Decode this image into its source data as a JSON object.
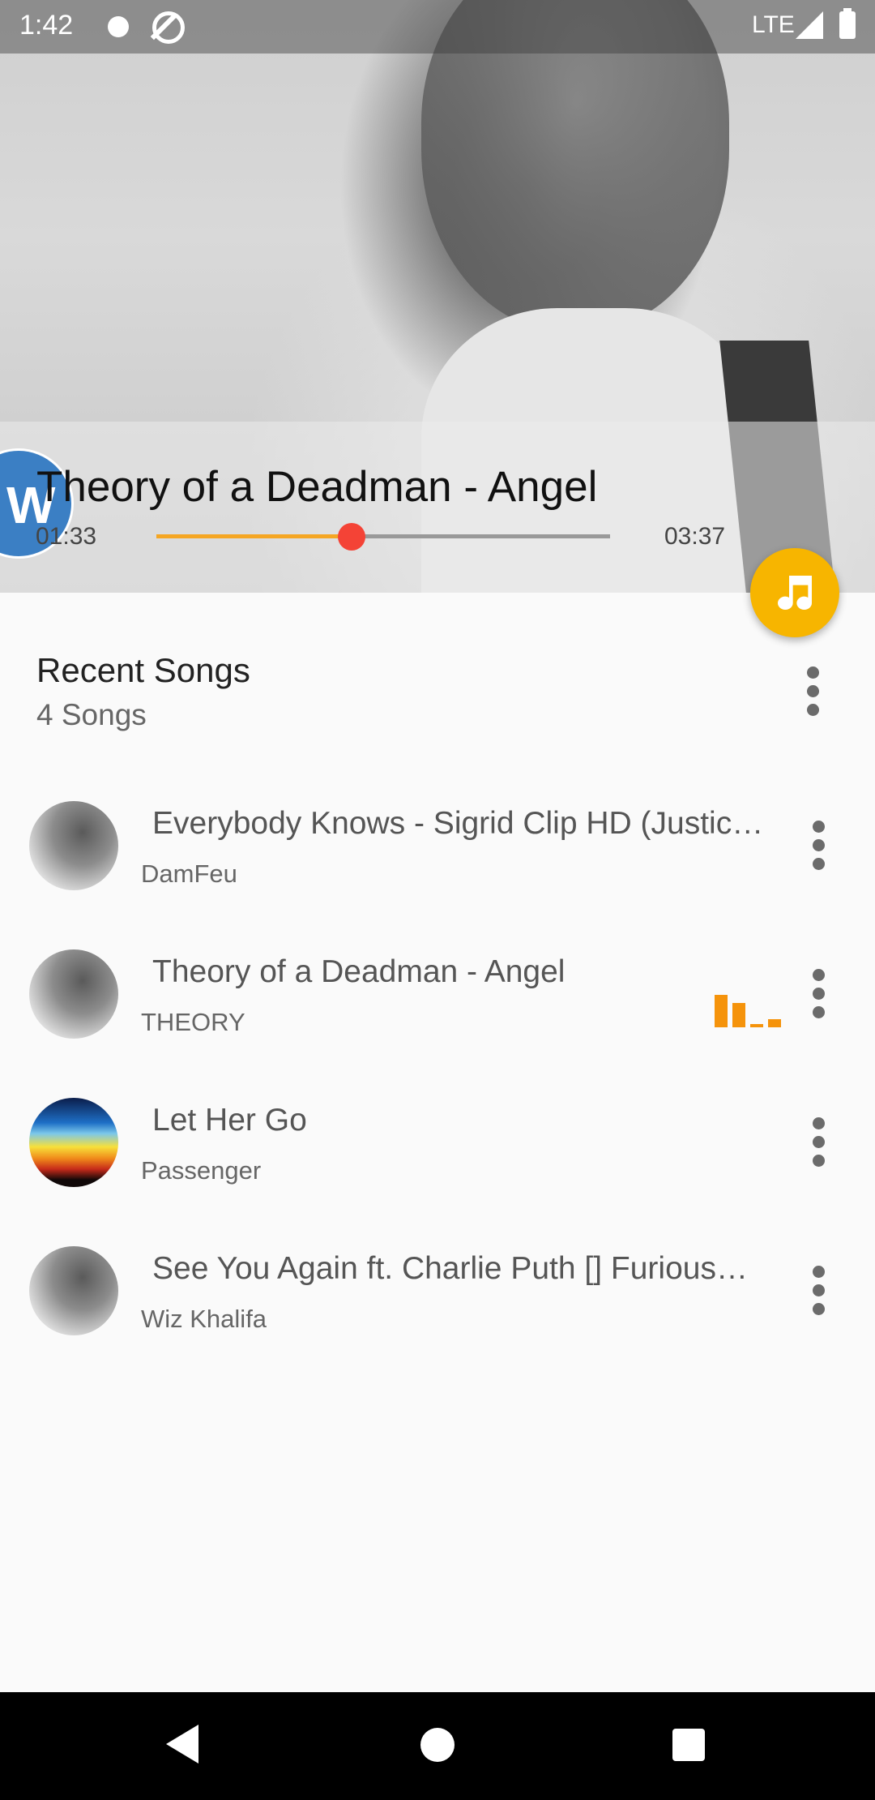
{
  "status_bar": {
    "time": "1:42",
    "network": "LTE"
  },
  "now_playing": {
    "title": "Theory of a Deadman - Angel",
    "elapsed": "01:33",
    "total": "03:37",
    "progress": 0.43,
    "logo_text": "W"
  },
  "section": {
    "title": "Recent Songs",
    "count": "4 Songs"
  },
  "songs": [
    {
      "title": "Everybody Knows - Sigrid Clip HD (Justic…",
      "artist": "DamFeu",
      "playing": false
    },
    {
      "title": "Theory of a Deadman - Angel",
      "artist": "THEORY",
      "playing": true
    },
    {
      "title": "Let Her Go",
      "artist": "Passenger",
      "playing": false
    },
    {
      "title": "See You Again ft. Charlie Puth [] Furious…",
      "artist": "Wiz Khalifa",
      "playing": false
    }
  ],
  "colors": {
    "accent": "#f7b500",
    "seek_fill": "#f5a623",
    "seek_thumb": "#f44336",
    "equalizer": "#f5930b"
  },
  "icons": {
    "fab": "music-note-icon",
    "more": "more-vert-icon",
    "playing": "equalizer-icon"
  }
}
